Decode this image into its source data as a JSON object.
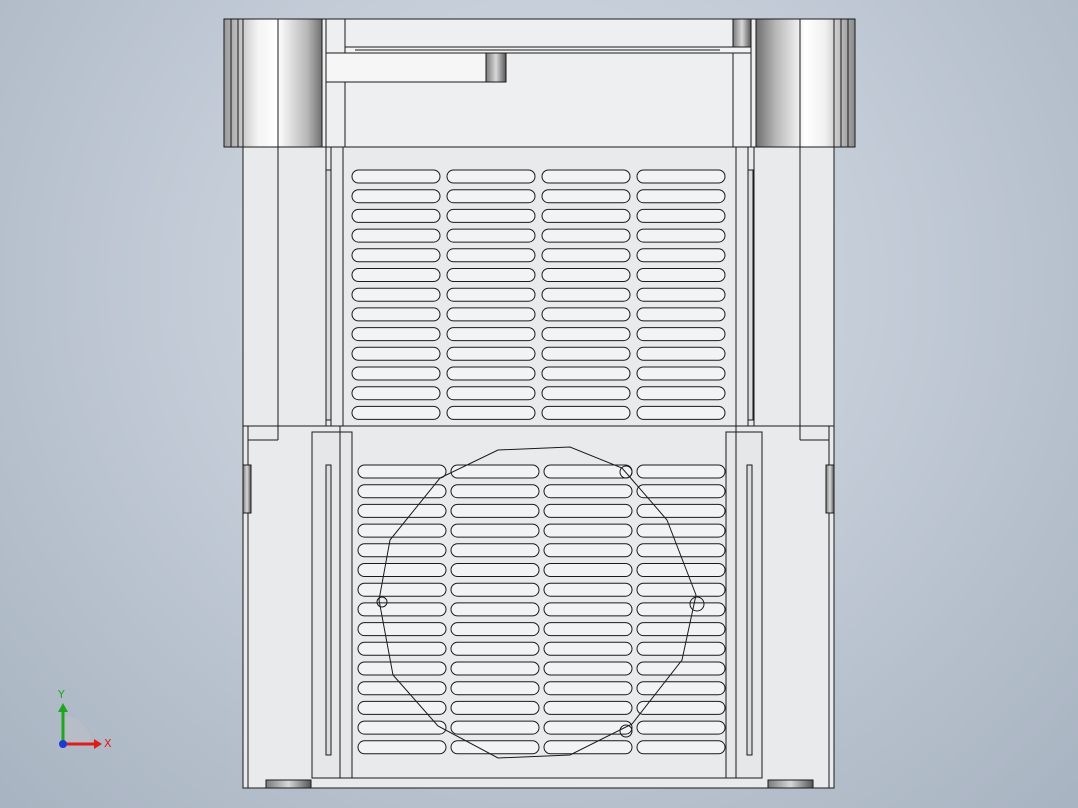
{
  "viewport": {
    "background_top": "#d6dee7",
    "background_bottom": "#a8b3c1",
    "model_fill": "#e9eaec",
    "edge_color": "#1a1a1a"
  },
  "triad": {
    "x_label": "X",
    "y_label": "Y",
    "x_color": "#e01b1b",
    "y_color": "#1fa51f",
    "z_color": "#1c3bd6"
  },
  "model": {
    "upper_vent_rows": 13,
    "upper_vent_cols": 4,
    "lower_vent_rows": 15,
    "lower_vent_cols": 4,
    "fan_outline_icon": "fan-shroud-icon"
  }
}
